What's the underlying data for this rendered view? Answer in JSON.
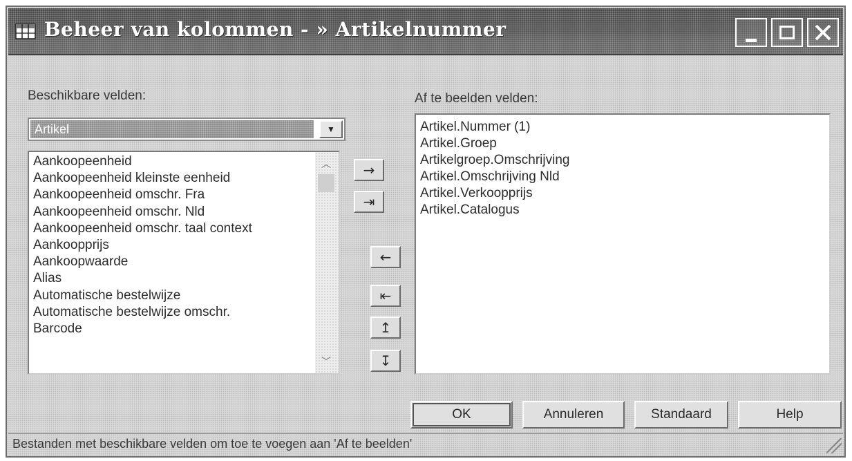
{
  "window": {
    "title": "Beheer van kolommen - » Artikelnummer",
    "controls": [
      "minimize-icon",
      "maximize-icon",
      "close-icon"
    ]
  },
  "left": {
    "label": "Beschikbare velden:",
    "combo_value": "Artikel",
    "items": [
      "Aankoopeenheid",
      "Aankoopeenheid kleinste eenheid",
      "Aankoopeenheid omschr. Fra",
      "Aankoopeenheid omschr. Nld",
      "Aankoopeenheid omschr. taal context",
      "Aankoopprijs",
      "Aankoopwaarde",
      "Alias",
      "Automatische bestelwijze",
      "Automatische bestelwijze omschr.",
      "Barcode"
    ]
  },
  "right": {
    "label": "Af te beelden velden:",
    "items": [
      "Artikel.Nummer (1)",
      "Artikel.Groep",
      "Artikelgroep.Omschrijving",
      "Artikel.Omschrijving Nld",
      "Artikel.Verkoopprijs",
      "Artikel.Catalogus"
    ]
  },
  "move_buttons": [
    {
      "name": "add-field",
      "glyph": "→"
    },
    {
      "name": "add-all-fields",
      "glyph": "⇥"
    },
    {
      "name": "remove-field",
      "glyph": "←"
    },
    {
      "name": "remove-all-fields",
      "glyph": "⇤"
    },
    {
      "name": "move-up",
      "glyph": "↥"
    },
    {
      "name": "move-down",
      "glyph": "↧"
    }
  ],
  "buttons": {
    "ok": "OK",
    "cancel": "Annuleren",
    "standard": "Standaard",
    "help": "Help"
  },
  "status": "Bestanden met beschikbare velden om toe te voegen aan 'Af te beelden'"
}
